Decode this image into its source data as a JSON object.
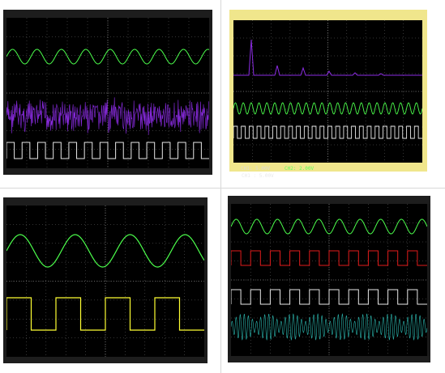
{
  "panels": {
    "top_right": {
      "ch1_label": "CH1",
      "ch1_scale": "5.00V",
      "ch2_label": "CH2",
      "ch2_scale": "2.00V"
    }
  },
  "colors": {
    "grid": "#6a6a6a",
    "screen": "#000000",
    "green": "#4cff4c",
    "purple": "#8a2be2",
    "white": "#e8e8e8",
    "yellow": "#ffff33",
    "red": "#e21b1b",
    "teal": "#2bb8b0",
    "border_right_panel": "#f0e68c"
  }
}
